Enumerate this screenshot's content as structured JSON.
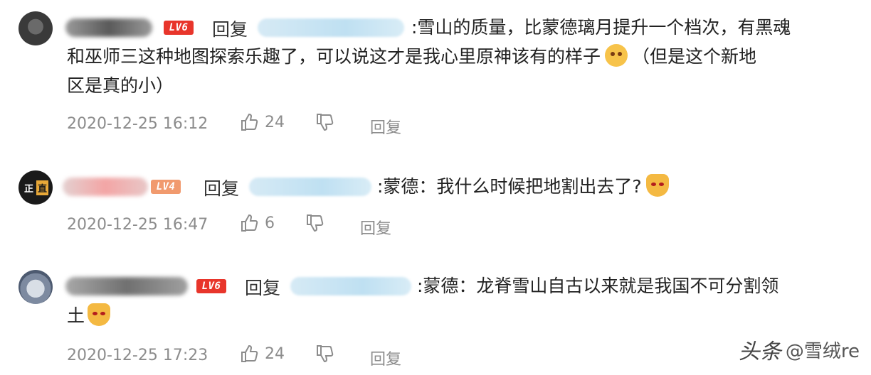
{
  "comments": [
    {
      "level": "LV6",
      "reply_keyword": "回复",
      "text_lines": [
        ":雪山的质量，比蒙德璃月提升一个档次，有黑魂",
        "和巫师三这种地图探索乐趣了，可以说这才是我心里原神该有的样子",
        "（但是这个新地",
        "区是真的小）"
      ],
      "emoji": "thinking-face",
      "timestamp": "2020-12-25 16:12",
      "like_count": "24",
      "reply_label": "回复"
    },
    {
      "level": "LV4",
      "reply_keyword": "回复",
      "text_lines": [
        ":蒙德：我什么时候把地割出去了?"
      ],
      "emoji": "cat-face",
      "timestamp": "2020-12-25 16:47",
      "like_count": "6",
      "reply_label": "回复"
    },
    {
      "level": "LV6",
      "reply_keyword": "回复",
      "text_lines": [
        ":蒙德：龙脊雪山自古以来就是我国不可分割领",
        "土"
      ],
      "emoji": "cat-face",
      "timestamp": "2020-12-25 17:23",
      "like_count": "24",
      "reply_label": "回复"
    }
  ],
  "avatar2_tag": [
    "正",
    "直"
  ],
  "watermark": {
    "logo": "头条",
    "text": "@雪绒re"
  },
  "colors": {
    "level6": "#e8352b",
    "level4": "#f19a6e",
    "meta": "#8c8c8c",
    "reply_target": "#bfe0f2"
  }
}
